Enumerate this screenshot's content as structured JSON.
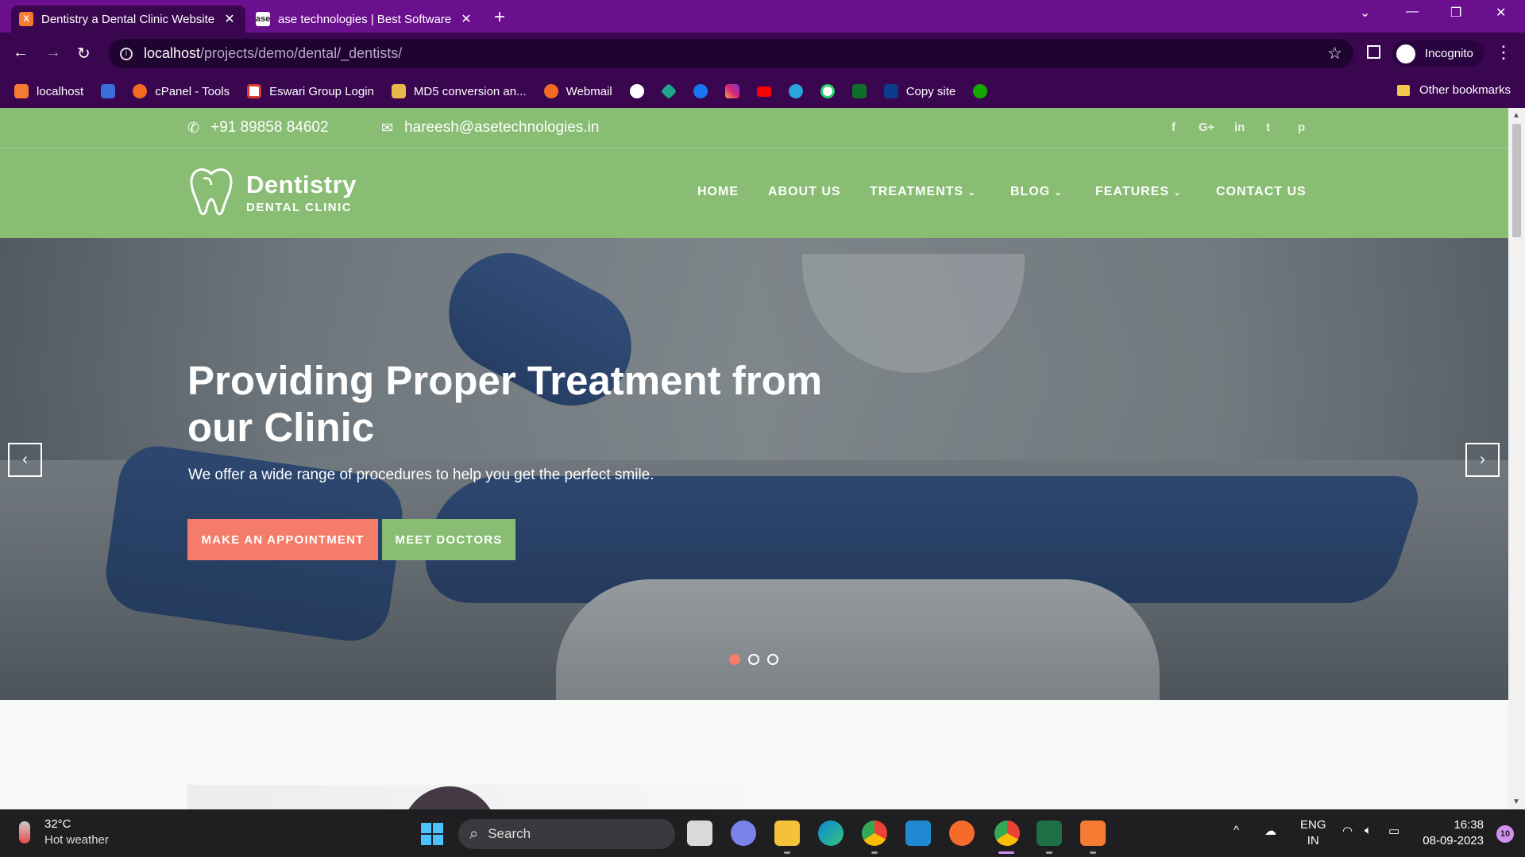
{
  "browser": {
    "tabs": [
      {
        "title": "Dentistry a Dental Clinic Website",
        "favicon": "xampp-icon",
        "active": true
      },
      {
        "title": "ase technologies | Best Software",
        "favicon": "ase-icon",
        "active": false
      }
    ],
    "url": {
      "host": "localhost",
      "path": "/projects/demo/dental/_dentists/"
    },
    "profile_label": "Incognito",
    "bookmarks": [
      {
        "label": "localhost",
        "icon": "xampp-icon"
      },
      {
        "label": "",
        "icon": "f-icon"
      },
      {
        "label": "cPanel - Tools",
        "icon": "cpanel-icon"
      },
      {
        "label": "Eswari Group Login",
        "icon": "g-icon"
      },
      {
        "label": "MD5 conversion an...",
        "icon": "key-icon"
      },
      {
        "label": "Webmail",
        "icon": "cpanel-icon"
      },
      {
        "label": "",
        "icon": "github-icon"
      },
      {
        "label": "",
        "icon": "diamond-icon"
      },
      {
        "label": "",
        "icon": "facebook-icon"
      },
      {
        "label": "",
        "icon": "instagram-icon"
      },
      {
        "label": "",
        "icon": "youtube-icon"
      },
      {
        "label": "",
        "icon": "telegram-icon"
      },
      {
        "label": "",
        "icon": "whatsapp-icon"
      },
      {
        "label": "",
        "icon": "folder-green-icon"
      },
      {
        "label": "Copy site",
        "icon": "w-icon"
      },
      {
        "label": "",
        "icon": "upwork-icon"
      }
    ],
    "other_bookmarks": "Other bookmarks"
  },
  "site": {
    "topbar": {
      "phone": "+91 89858 84602",
      "email": "hareesh@asetechnologies.in",
      "social": [
        "f",
        "G+",
        "in",
        "t",
        "p"
      ]
    },
    "logo": {
      "name": "Dentistry",
      "tagline": "DENTAL CLINIC"
    },
    "menu": [
      {
        "label": "HOME",
        "dropdown": false
      },
      {
        "label": "ABOUT US",
        "dropdown": false
      },
      {
        "label": "TREATMENTS",
        "dropdown": true
      },
      {
        "label": "BLOG",
        "dropdown": true
      },
      {
        "label": "FEATURES",
        "dropdown": true
      },
      {
        "label": "CONTACT US",
        "dropdown": false
      }
    ],
    "hero": {
      "title": "Providing Proper Treatment from our Clinic",
      "subtitle": "We offer a wide range of procedures to help you get the perfect smile.",
      "primary_button": "MAKE AN APPOINTMENT",
      "secondary_button": "MEET DOCTORS",
      "slides": 3,
      "active_slide": 1
    },
    "colors": {
      "green": "#88bd73",
      "coral": "#f47c68"
    }
  },
  "taskbar": {
    "weather": {
      "temp": "32°C",
      "desc": "Hot weather"
    },
    "search_placeholder": "Search",
    "language": {
      "line1": "ENG",
      "line2": "IN"
    },
    "time": "16:38",
    "date": "08-09-2023",
    "notifications": "10"
  }
}
